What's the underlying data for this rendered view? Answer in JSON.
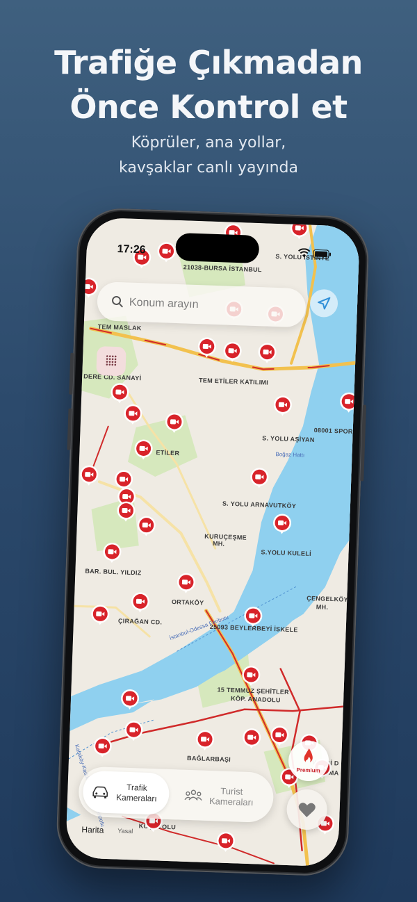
{
  "promo": {
    "headline_line1": "Trafiğe Çıkmadan",
    "headline_line2": "Önce Kontrol et",
    "subtitle_line1": "Köprüler, ana yollar,",
    "subtitle_line2": "kavşaklar canlı yayında"
  },
  "status_bar": {
    "time": "17:26",
    "icons": [
      "wifi-icon",
      "battery-icon"
    ]
  },
  "search": {
    "placeholder": "Konum arayın",
    "icon": "search-icon"
  },
  "map": {
    "labels": [
      "21038-BURSA İSTANBUL",
      "S. YOLU İSTİNYE",
      "TEM MASLAK",
      "DERE CD. SANAYİ",
      "TEM ETİLER KATILIMI",
      "08001 SPOR",
      "S. YOLU AŞİYAN",
      "Boğaz Hattı",
      "ETİLER",
      "S. YOLU ARNAVUTKÖY",
      "KURUÇEŞME",
      "MH.",
      "S.YOLU KULELİ",
      "BAR. BUL. YILDIZ",
      "ORTAKÖY",
      "ÇENGELKÖY",
      "MH.",
      "ÇIRAĞAN CD.",
      "İstanbul-Odessa Feribotu",
      "25093  BEYLERBEYİ İSKELE",
      "15 TEMMUZ ŞEHİTLER",
      "KÖP. ANADOLU",
      "BAĞLARBAŞI",
      "VECDİ D",
      "KIRMA",
      "KOŞUYOLU",
      "Karaköy-Kadıköy-Kadıköy Feribotu"
    ],
    "camera_icon": "traffic-camera-pin-icon",
    "colors": {
      "water": "#8fd0ef",
      "land": "#efebe3",
      "park": "#cfe5b4",
      "pin": "#d8232a",
      "congestion": "#d02a2a",
      "road_major": "#f0b429"
    }
  },
  "controls": {
    "locate_icon": "location-arrow-icon",
    "grid_icon": "grid-toggle-icon"
  },
  "tabs": {
    "traffic": {
      "label_line1": "Trafik",
      "label_line2": "Kameraları",
      "icon": "car-icon",
      "active": true
    },
    "tourist": {
      "label_line1": "Turist",
      "label_line2": "Kameraları",
      "icon": "people-icon",
      "active": false
    }
  },
  "premium": {
    "label": "Premium",
    "icon": "flame-icon"
  },
  "favorites": {
    "icon": "heart-icon"
  },
  "attribution": {
    "maps": "Harita",
    "legal": "Yasal"
  }
}
